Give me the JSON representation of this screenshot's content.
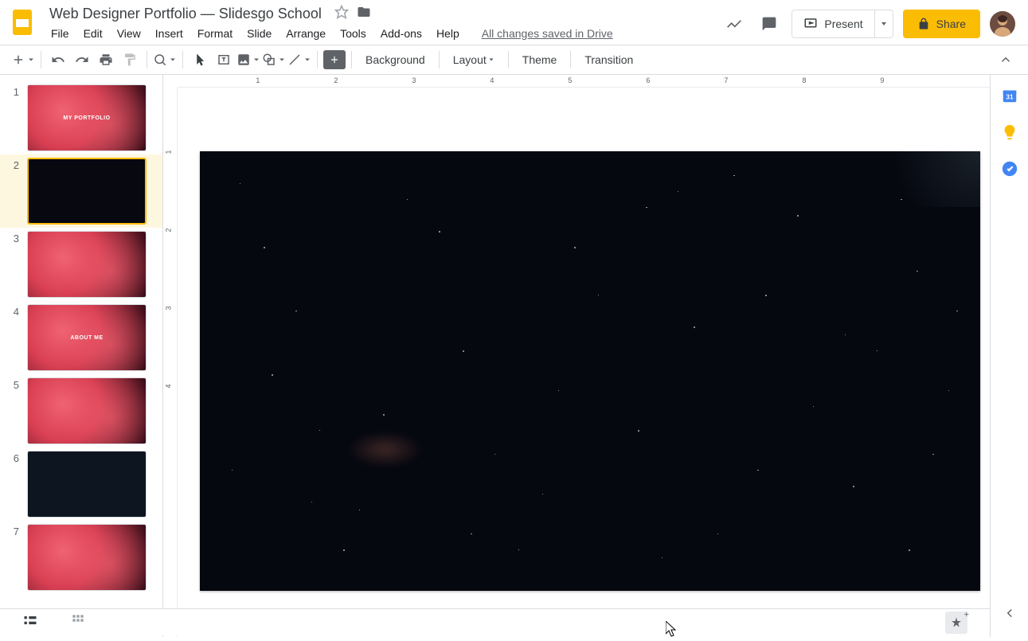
{
  "doc": {
    "title": "Web Designer Portfolio — Slidesgo School",
    "save_status": "All changes saved in Drive"
  },
  "menu": {
    "file": "File",
    "edit": "Edit",
    "view": "View",
    "insert": "Insert",
    "format": "Format",
    "slide": "Slide",
    "arrange": "Arrange",
    "tools": "Tools",
    "addons": "Add-ons",
    "help": "Help"
  },
  "header_actions": {
    "present": "Present",
    "share": "Share"
  },
  "toolbar": {
    "background": "Background",
    "layout": "Layout",
    "theme": "Theme",
    "transition": "Transition"
  },
  "slides": [
    {
      "num": "1",
      "style": "red",
      "title": "MY PORTFOLIO"
    },
    {
      "num": "2",
      "style": "dark",
      "title": ""
    },
    {
      "num": "3",
      "style": "red",
      "title": ""
    },
    {
      "num": "4",
      "style": "red",
      "title": "ABOUT ME"
    },
    {
      "num": "5",
      "style": "red",
      "title": ""
    },
    {
      "num": "6",
      "style": "dark-map",
      "title": ""
    },
    {
      "num": "7",
      "style": "red",
      "title": ""
    }
  ],
  "selected_slide": 2,
  "ruler_h": [
    "1",
    "2",
    "3",
    "4",
    "5",
    "6",
    "7",
    "8",
    "9"
  ],
  "ruler_v": [
    "1",
    "2",
    "3",
    "4"
  ],
  "calendar_day": "31"
}
